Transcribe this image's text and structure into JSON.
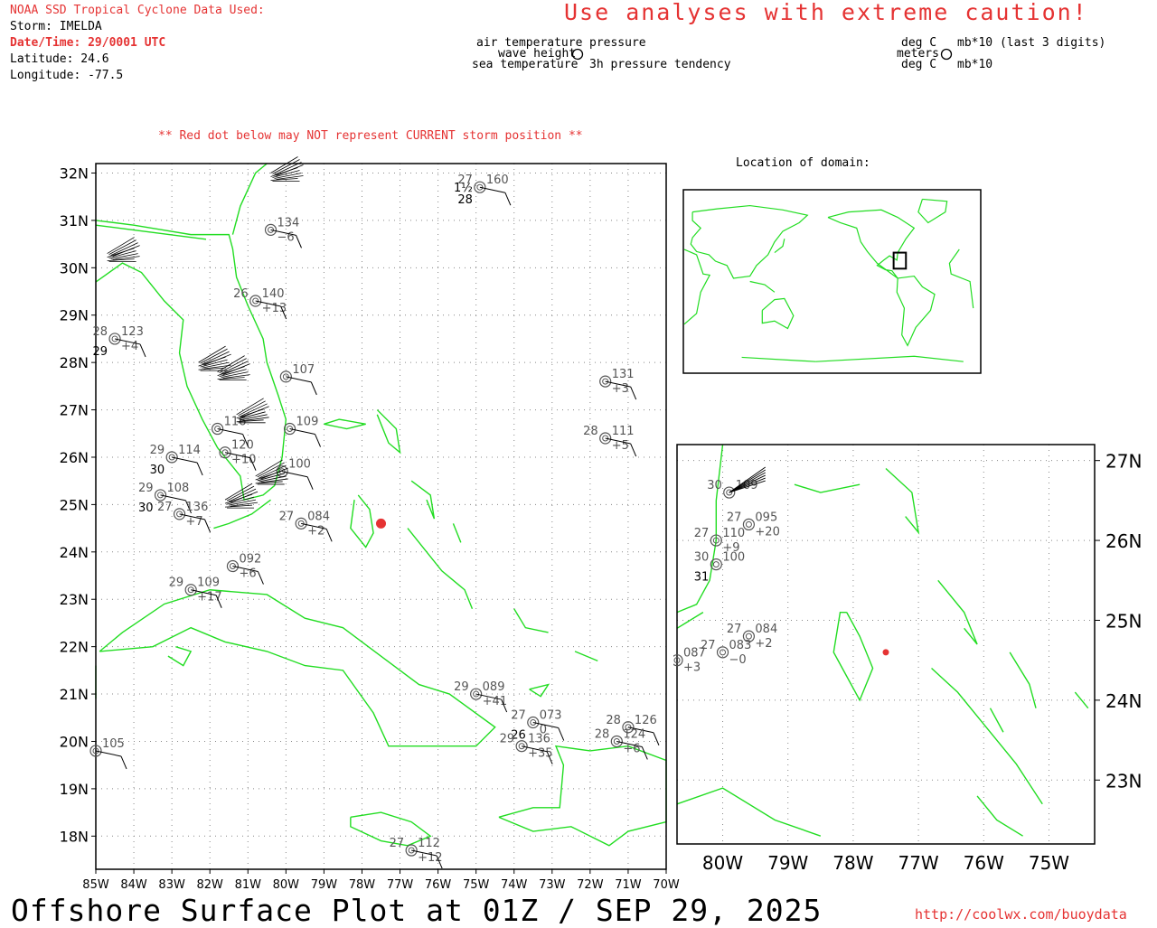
{
  "header": {
    "source_title": "NOAA SSD Tropical Cyclone Data Used:",
    "storm_line": "Storm: IMELDA",
    "datetime_line": "Date/Time: 29/0001 UTC",
    "latitude_line": "Latitude: 24.6",
    "longitude_line": "Longitude: -77.5",
    "caution": "Use analyses with extreme caution!",
    "red_dot_note": "** Red dot below may NOT represent CURRENT storm position **"
  },
  "legend": {
    "left_air": "air temperature",
    "left_wave": "wave height",
    "left_sea": "sea temperature",
    "left_pressure": "pressure",
    "left_tendency": "3h pressure tendency",
    "right_air": "deg C",
    "right_wave": "meters",
    "right_sea": "deg C",
    "right_pressure": "mb*10 (last 3 digits)",
    "right_tendency": "mb*10"
  },
  "location_title": "Location of domain:",
  "main_map": {
    "lat_labels": [
      "32N",
      "31N",
      "30N",
      "29N",
      "28N",
      "27N",
      "26N",
      "25N",
      "24N",
      "23N",
      "22N",
      "21N",
      "20N",
      "19N",
      "18N"
    ],
    "lon_labels": [
      "85W",
      "84W",
      "83W",
      "82W",
      "81W",
      "80W",
      "79W",
      "78W",
      "77W",
      "76W",
      "75W",
      "74W",
      "73W",
      "72W",
      "71W",
      "70W"
    ],
    "storm": {
      "lat": 24.6,
      "lon": -77.5
    },
    "stations": [
      {
        "lat": 31.7,
        "lon": -74.9,
        "t": "27",
        "p": "160",
        "w": "1½",
        "s": "28"
      },
      {
        "lat": 30.8,
        "lon": -80.4,
        "p": "134",
        "tend": "−6"
      },
      {
        "lat": 28.5,
        "lon": -84.5,
        "t": "28",
        "p": "123",
        "s": "29",
        "tend": "+4"
      },
      {
        "lat": 27.6,
        "lon": -71.6,
        "p": "131",
        "tend": "+3"
      },
      {
        "lat": 26.4,
        "lon": -71.6,
        "t": "28",
        "p": "111",
        "tend": "+5"
      },
      {
        "lat": 26.0,
        "lon": -83.0,
        "t": "29",
        "p": "114",
        "s": "30"
      },
      {
        "lat": 25.2,
        "lon": -83.3,
        "t": "29",
        "p": "108",
        "s": "30"
      },
      {
        "lat": 24.8,
        "lon": -82.8,
        "t": "27",
        "p": "136",
        "tend": "+7"
      },
      {
        "lat": 24.6,
        "lon": -79.6,
        "t": "27",
        "p": "084",
        "tend": "+2"
      },
      {
        "lat": 23.7,
        "lon": -81.4,
        "p": "092",
        "tend": "+6"
      },
      {
        "lat": 23.2,
        "lon": -82.5,
        "t": "29",
        "p": "109",
        "tend": "+17"
      },
      {
        "lat": 21.0,
        "lon": -75.0,
        "t": "29",
        "p": "089",
        "tend": "+41"
      },
      {
        "lat": 20.4,
        "lon": -73.5,
        "t": "27",
        "p": "073",
        "s": "26",
        "tend": "0"
      },
      {
        "lat": 19.9,
        "lon": -73.8,
        "t": "29",
        "p": "136",
        "tend": "+35"
      },
      {
        "lat": 20.3,
        "lon": -71.0,
        "t": "28",
        "p": "126"
      },
      {
        "lat": 20.0,
        "lon": -71.3,
        "t": "28",
        "p": "124",
        "tend": "+6"
      },
      {
        "lat": 17.7,
        "lon": -76.7,
        "t": "27",
        "p": "112",
        "tend": "+12"
      },
      {
        "lat": 19.8,
        "lon": -85.0,
        "p": "105"
      },
      {
        "lat": 26.6,
        "lon": -79.9,
        "p": "109"
      },
      {
        "lat": 25.7,
        "lon": -80.1,
        "p": "100"
      },
      {
        "lat": 26.1,
        "lon": -81.6,
        "p": "120",
        "tend": "+10"
      },
      {
        "lat": 26.6,
        "lon": -81.8,
        "p": "116"
      },
      {
        "lat": 29.3,
        "lon": -80.8,
        "t": "26",
        "p": "140",
        "tend": "+13"
      },
      {
        "lat": 27.7,
        "lon": -80.0,
        "p": "107"
      }
    ]
  },
  "inset_map": {
    "lat_labels": [
      "27N",
      "26N",
      "25N",
      "24N",
      "23N"
    ],
    "lon_labels": [
      "80W",
      "79W",
      "78W",
      "77W",
      "76W",
      "75W"
    ],
    "storm": {
      "lat": 24.6,
      "lon": -77.5
    },
    "stations": [
      {
        "lat": 26.6,
        "lon": -79.9,
        "t": "30",
        "p": "109"
      },
      {
        "lat": 26.2,
        "lon": -79.6,
        "t": "27",
        "p": "095",
        "tend": "+20"
      },
      {
        "lat": 26.0,
        "lon": -80.1,
        "t": "27",
        "p": "110",
        "tend": "+9"
      },
      {
        "lat": 25.7,
        "lon": -80.1,
        "t": "30",
        "p": "100",
        "s": "31"
      },
      {
        "lat": 24.8,
        "lon": -79.6,
        "t": "27",
        "p": "084",
        "tend": "+2"
      },
      {
        "lat": 24.6,
        "lon": -80.0,
        "t": "27",
        "p": "083",
        "tend": "−0"
      },
      {
        "lat": 24.5,
        "lon": -80.7,
        "p": "087",
        "tend": "+3"
      }
    ]
  },
  "footer": {
    "title": "Offshore Surface Plot at 01Z / SEP 29, 2025",
    "url": "http://coolwx.com/buoydata"
  },
  "colors": {
    "coast": "#22dd22",
    "red": "#e53333",
    "grid": "#888888"
  }
}
